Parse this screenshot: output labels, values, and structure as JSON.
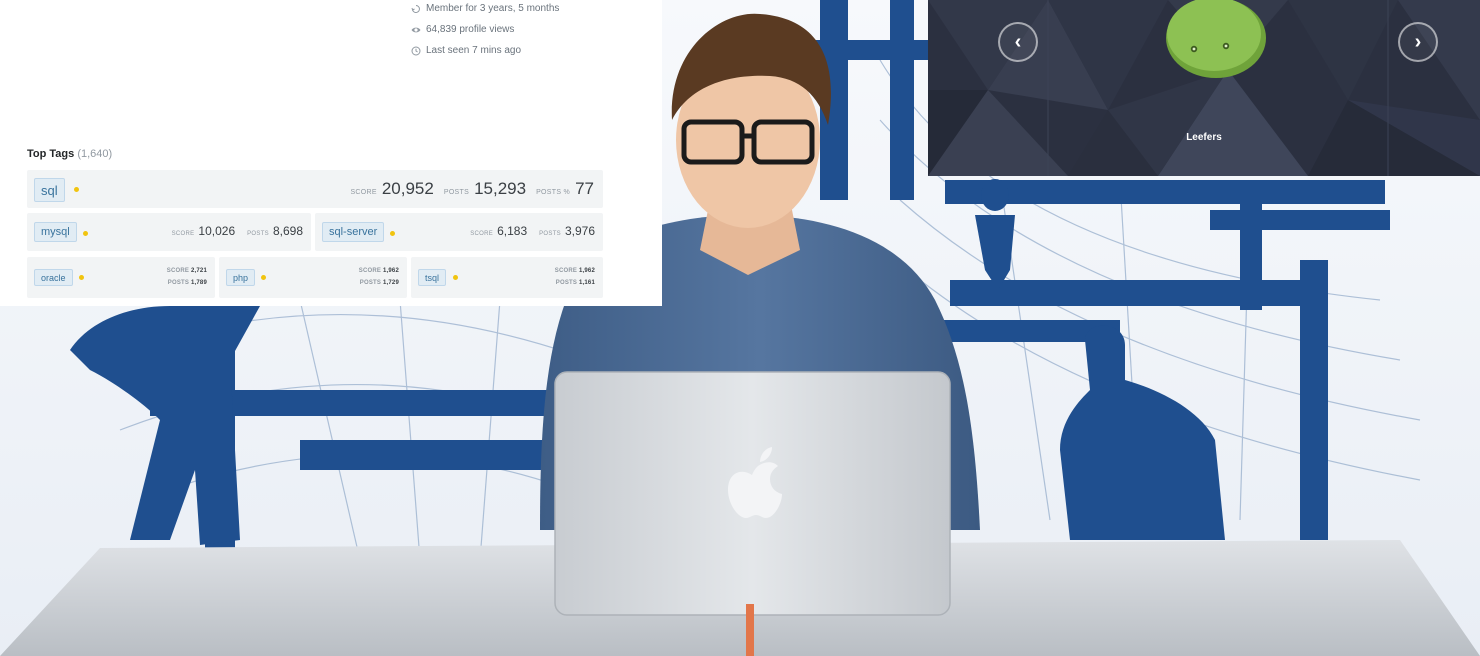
{
  "profile": {
    "stats": [
      {
        "icon": "history-icon",
        "text": "Member for 3 years, 5 months"
      },
      {
        "icon": "eye-icon",
        "text": "64,839 profile views"
      },
      {
        "icon": "clock-icon",
        "text": "Last seen 7 mins ago"
      }
    ],
    "top_tags": {
      "title": "Top Tags",
      "count": "(1,640)",
      "score_label": "SCORE",
      "posts_label": "POSTS",
      "posts_pct_label": "POSTS %",
      "primary": {
        "tag": "sql",
        "score": "20,952",
        "posts": "15,293",
        "posts_pct": "77"
      },
      "secondary": [
        {
          "tag": "mysql",
          "score": "10,026",
          "posts": "8,698"
        },
        {
          "tag": "sql-server",
          "score": "6,183",
          "posts": "3,976"
        }
      ],
      "tertiary": [
        {
          "tag": "oracle",
          "score": "2,721",
          "posts": "1,789"
        },
        {
          "tag": "php",
          "score": "1,962",
          "posts": "1,729"
        },
        {
          "tag": "tsql",
          "score": "1,962",
          "posts": "1,161"
        }
      ],
      "dot_color": "#f1c40f"
    }
  },
  "carousel": {
    "caption": "Leefers",
    "prev_icon": "chevron-left-icon",
    "next_icon": "chevron-right-icon",
    "prev_glyph": "‹",
    "next_glyph": "›",
    "mascot_color": "#8dc153"
  },
  "colors": {
    "brand_blue": "#1f4f8f",
    "tag_bg": "#e1ecf4",
    "tag_text": "#39739d"
  }
}
